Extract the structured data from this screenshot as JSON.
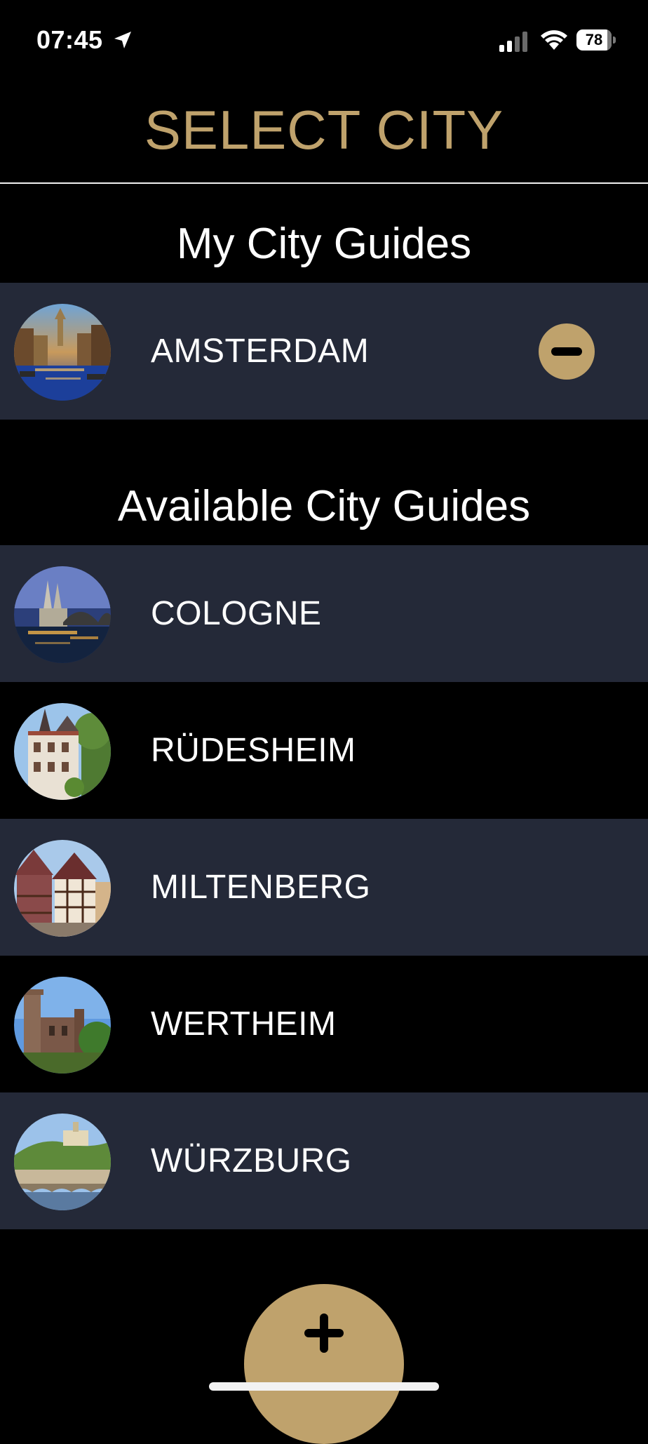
{
  "status_bar": {
    "time": "07:45",
    "battery": "78",
    "icons": [
      "location-arrow-icon",
      "cellular-signal-icon",
      "wifi-icon",
      "battery-icon"
    ]
  },
  "header": {
    "title": "SELECT CITY",
    "title_color": "#bfa26c"
  },
  "my_guides": {
    "title": "My City Guides",
    "items": [
      {
        "name": "AMSTERDAM",
        "action_icon": "minus-circle-icon"
      }
    ]
  },
  "available_guides": {
    "title": "Available City Guides",
    "items": [
      {
        "name": "COLOGNE"
      },
      {
        "name": "RÜDESHEIM"
      },
      {
        "name": "MILTENBERG"
      },
      {
        "name": "WERTHEIM"
      },
      {
        "name": "WÜRZBURG"
      }
    ]
  },
  "fab": {
    "icon": "plus-icon"
  },
  "colors": {
    "accent": "#bfa26c",
    "row_alt": "#242938",
    "background": "#000000"
  }
}
